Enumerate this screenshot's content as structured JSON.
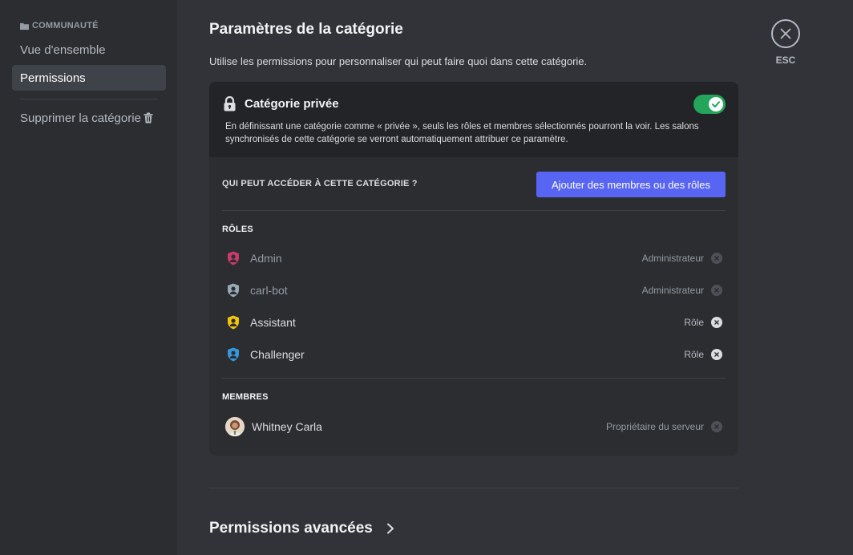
{
  "sidebar": {
    "header": "COMMUNAUTÉ",
    "items": [
      {
        "label": "Vue d'ensemble"
      },
      {
        "label": "Permissions"
      },
      {
        "label": "Supprimer la catégorie"
      }
    ]
  },
  "page": {
    "title": "Paramètres de la catégorie",
    "subtitle": "Utilise les permissions pour personnaliser qui peut faire quoi dans cette catégorie.",
    "esc_label": "ESC"
  },
  "private": {
    "title": "Catégorie privée",
    "enabled": true,
    "description": "En définissant une catégorie comme « privée », seuls les rôles et membres sélectionnés pourront la voir. Les salons synchronisés de cette catégorie se verront automatiquement attribuer ce paramètre."
  },
  "access": {
    "label": "QUI PEUT ACCÉDER À CETTE CATÉGORIE ?",
    "add_button": "Ajouter des membres ou des rôles"
  },
  "roles": {
    "label": "RÔLES",
    "items": [
      {
        "name": "Admin",
        "type": "Administrateur",
        "color": "#c93b6a",
        "removable": false
      },
      {
        "name": "carl-bot",
        "type": "Administrateur",
        "color": "#99aab5",
        "removable": false
      },
      {
        "name": "Assistant",
        "type": "Rôle",
        "color": "#f1c40f",
        "removable": true
      },
      {
        "name": "Challenger",
        "type": "Rôle",
        "color": "#3498db",
        "removable": true
      }
    ]
  },
  "members": {
    "label": "MEMBRES",
    "items": [
      {
        "name": "Whitney Carla",
        "type": "Propriétaire du serveur",
        "removable": false
      }
    ]
  },
  "advanced": {
    "title": "Permissions avancées"
  },
  "colors": {
    "accent": "#5865f2",
    "toggle_on": "#23a55a"
  }
}
